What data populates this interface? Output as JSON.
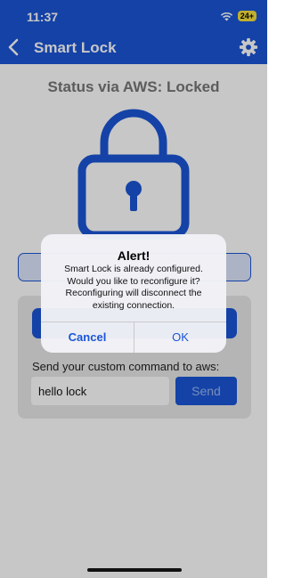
{
  "statusbar": {
    "time": "11:37",
    "battery": "24+"
  },
  "navbar": {
    "title": "Smart Lock"
  },
  "main": {
    "status_title": "Status via AWS: Locked",
    "custom_command_label": "Send your custom command to aws:",
    "custom_command_value": "hello lock",
    "send_label": "Send"
  },
  "alert": {
    "title": "Alert!",
    "message": "Smart Lock is already configured. Would you like to reconfigure it? Reconfiguring will disconnect the existing connection.",
    "cancel_label": "Cancel",
    "ok_label": "OK"
  },
  "colors": {
    "accent": "#1a55d6",
    "battery": "#f7e03c"
  },
  "icons": [
    "back-chevron-icon",
    "gear-icon",
    "lock-icon",
    "wifi-icon"
  ]
}
